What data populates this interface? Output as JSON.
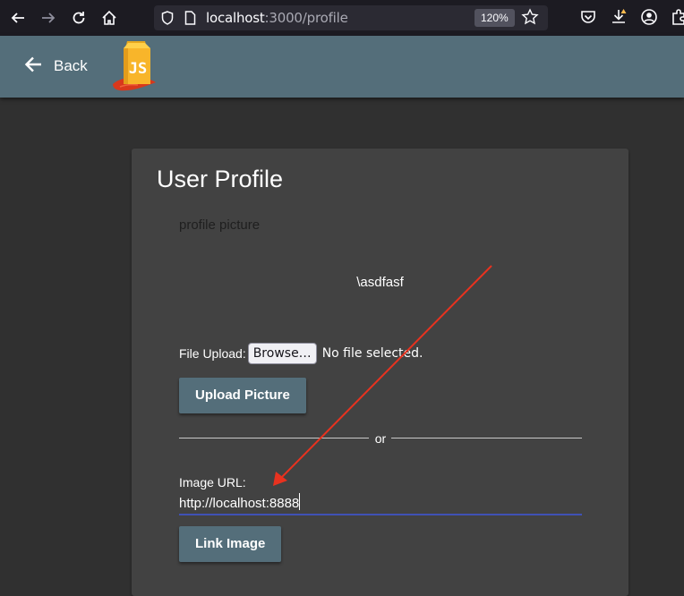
{
  "browser": {
    "url_host": "localhost",
    "url_path": ":3000/profile",
    "zoom": "120%"
  },
  "header": {
    "back_label": "Back",
    "logo_text": "JS"
  },
  "profile": {
    "title": "User Profile",
    "picture_label": "profile picture",
    "username": "\\asdfasf",
    "file_upload_label": "File Upload:",
    "browse_label": "Browse…",
    "no_file_text": "No file selected.",
    "upload_button": "Upload Picture",
    "or_text": "or",
    "image_url_label": "Image URL:",
    "image_url_value": "http://localhost:8888",
    "link_button": "Link Image"
  },
  "colors": {
    "header_bg": "#546e7a",
    "page_bg": "#303030",
    "card_bg": "#424242",
    "input_underline": "#3f51b5",
    "annotation_arrow": "#e8321f"
  }
}
